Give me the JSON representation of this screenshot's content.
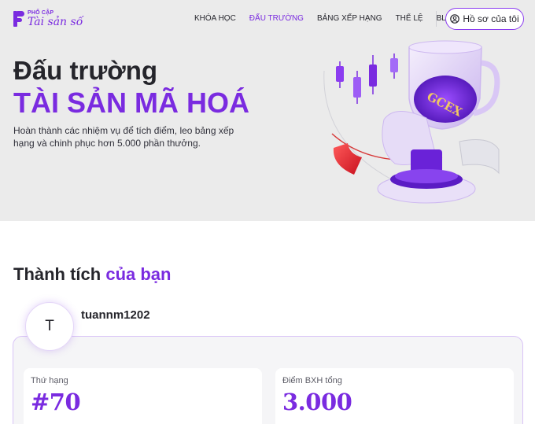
{
  "brand": {
    "top": "PHỔ CẬP",
    "bottom": "Tài sản số",
    "logo_icon": "brand-p-mark",
    "color": "#7a2be0"
  },
  "nav": [
    {
      "label": "KHÓA HỌC",
      "active": false
    },
    {
      "label": "ĐẤU TRƯỜNG",
      "active": true
    },
    {
      "label": "BẢNG XẾP HẠNG",
      "active": false
    },
    {
      "label": "THỂ LỆ",
      "active": false
    },
    {
      "label": "BLOG",
      "active": false
    }
  ],
  "profile_button": {
    "label": "Hồ sơ của tôi",
    "icon": "user-circle-icon"
  },
  "hero": {
    "title_line1": "Đấu trường",
    "title_line2": "TÀI SẢN MÃ HOÁ",
    "description": "Hoàn thành các nhiệm vụ để tích điểm, leo bảng xếp hạng và chinh phục hơn 5.000 phần thưởng.",
    "image_icon": "trophy-illustration",
    "trophy_text": "GCEX"
  },
  "achievements": {
    "title_plain": "Thành tích ",
    "title_accent": "của bạn",
    "avatar_initial": "T",
    "username": "tuannm1202",
    "stats": [
      {
        "label": "Thứ hạng",
        "value": "#70"
      },
      {
        "label": "Điểm BXH tổng",
        "value": "3.000"
      }
    ]
  },
  "colors": {
    "accent": "#7a2be0",
    "hero_bg": "#ebebeb",
    "text": "#25252b"
  }
}
